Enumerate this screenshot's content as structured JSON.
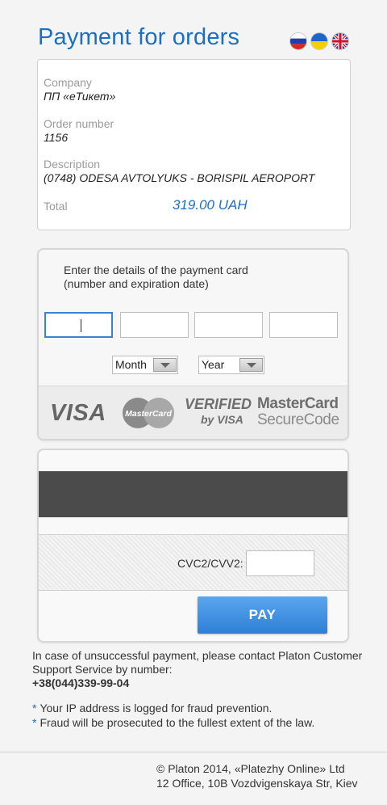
{
  "header": {
    "title": "Payment for orders",
    "languages": [
      {
        "code": "ru",
        "icon": "russia-flag-icon"
      },
      {
        "code": "ua",
        "icon": "ukraine-flag-icon"
      },
      {
        "code": "en",
        "icon": "uk-flag-icon"
      }
    ]
  },
  "order": {
    "company_label": "Company",
    "company_value": "ПП «еТикет»",
    "order_number_label": "Order number",
    "order_number_value": "1156",
    "description_label": "Description",
    "description_value": "(0748) ODESA AVTOLYUKS - BORISPIL AEROPORT",
    "total_label": "Total",
    "total_value": "319.00 UAH"
  },
  "card_front": {
    "prompt_line1": "Enter the details of the payment card",
    "prompt_line2": "(number and expiration date)",
    "number_fields": [
      "",
      "",
      "",
      ""
    ],
    "month_label": "Month",
    "year_label": "Year",
    "logos": {
      "visa": "VISA",
      "mastercard": "MasterCard",
      "verified_line1": "VERIFIED",
      "verified_line2": "by VISA",
      "securecode_line1": "MasterCard",
      "securecode_line2": "SecureCode"
    }
  },
  "card_back": {
    "cvc_label": "CVC2/CVV2:",
    "cvc_value": "",
    "pay_label": "PAY"
  },
  "support": {
    "text": "In case of unsuccessful payment, please contact Platon Customer Support Service by number:",
    "phone": "+38(044)339-99-04"
  },
  "notes": [
    "Your IP address is logged for fraud prevention.",
    "Fraud will be prosecuted to the fullest extent of the law."
  ],
  "footer": {
    "line1": "© Platon 2014, «Platezhy Online» Ltd",
    "line2": "12 Office, 10B Vozdvigenskaya Str, Kiev"
  },
  "colors": {
    "accent": "#1b6fc4",
    "pay_button": "#3d8fe0",
    "background": "#f4f4f4"
  }
}
